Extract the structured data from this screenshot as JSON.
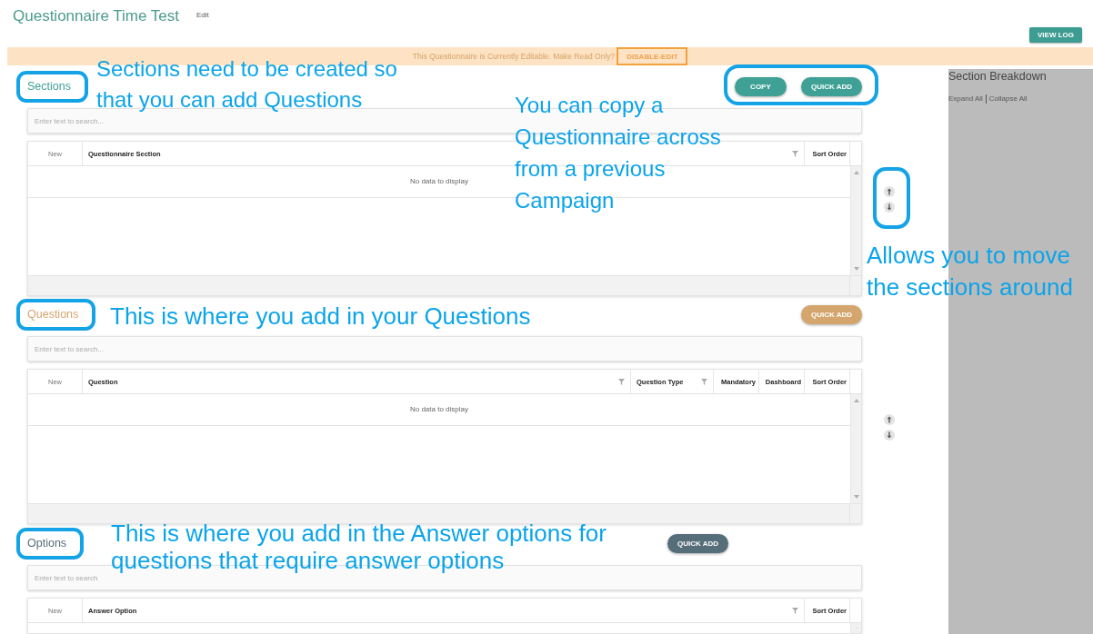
{
  "header": {
    "title": "Questionnaire Time Test",
    "mode_link": "Edit",
    "view_log_button": "VIEW LOG"
  },
  "notice_bar": {
    "message": "This Questionnaire is Currently Editable. Make Read Only?",
    "button": "DISABLE-EDIT"
  },
  "sections": [
    {
      "title": "Sections",
      "title_highlighted": true,
      "color": "#3fa196",
      "buttons": [
        {
          "label": "COPY"
        },
        {
          "label": "QUICK ADD"
        }
      ],
      "buttons_highlighted": true,
      "search": {
        "placeholder": "Enter text to search..."
      },
      "table": {
        "columns": [
          {
            "label": "New",
            "kind": "new",
            "filter": false
          },
          {
            "label": "Questionnaire Section",
            "kind": "main",
            "filter": true
          },
          {
            "label": "Sort Order",
            "kind": "order",
            "filter": false
          }
        ],
        "empty_text": "No data to display"
      },
      "reorder": {
        "highlighted": true
      }
    },
    {
      "title": "Questions",
      "title_highlighted": true,
      "color": "#d4a56c",
      "buttons": [
        {
          "label": "QUICK ADD"
        }
      ],
      "buttons_highlighted": false,
      "search": {
        "placeholder": "Enter text to search..."
      },
      "table": {
        "columns": [
          {
            "label": "New",
            "kind": "new",
            "filter": false
          },
          {
            "label": "Question",
            "kind": "main",
            "filter": true
          },
          {
            "label": "Question Type",
            "kind": "type",
            "filter": true
          },
          {
            "label": "Mandatory",
            "kind": "flag",
            "filter": false
          },
          {
            "label": "Dashboard",
            "kind": "flag",
            "filter": false
          },
          {
            "label": "Sort Order",
            "kind": "order",
            "filter": false
          }
        ],
        "empty_text": "No data to display"
      },
      "reorder": {
        "highlighted": false
      }
    },
    {
      "title": "Options",
      "title_highlighted": true,
      "color": "#566d7a",
      "buttons": [
        {
          "label": "QUICK ADD"
        }
      ],
      "buttons_highlighted": false,
      "search": {
        "placeholder": "Enter text to search"
      },
      "table": {
        "columns": [
          {
            "label": "New",
            "kind": "new",
            "filter": false
          },
          {
            "label": "Answer Option",
            "kind": "main",
            "filter": true
          },
          {
            "label": "Sort Order",
            "kind": "order",
            "filter": false
          }
        ]
      }
    }
  ],
  "section_breakdown": {
    "title": "Section Breakdown",
    "links": [
      "Expand All",
      "Collapse All"
    ]
  },
  "annotations": [
    {
      "text": "Sections need to be created so that you can add Questions"
    },
    {
      "text": "You can copy a Questionnaire across from a previous Campaign"
    },
    {
      "text": "Allows you to move the sections around"
    },
    {
      "text": "This is where you add in your Questions"
    },
    {
      "text": "This is where you add in the Answer options for questions that require answer options"
    }
  ]
}
